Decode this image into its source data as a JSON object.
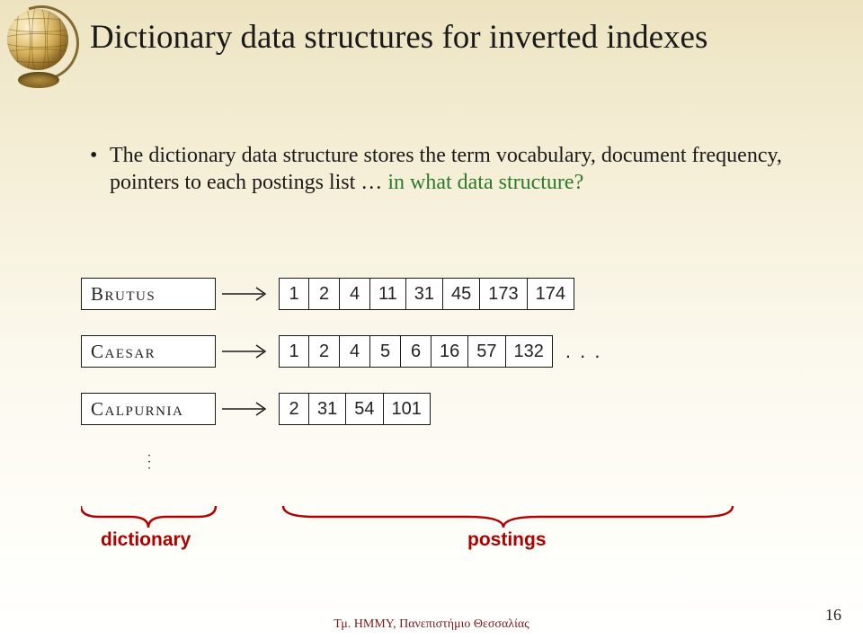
{
  "title": "Dictionary data structures for inverted indexes",
  "bullet": {
    "pre": "The dictionary data structure stores the term vocabulary, document frequency, pointers to each postings list … ",
    "question": "in what data structure?"
  },
  "terms": [
    {
      "name": "Brutus",
      "postings": [
        "1",
        "2",
        "4",
        "11",
        "31",
        "45",
        "173",
        "174"
      ],
      "more": false
    },
    {
      "name": "Caesar",
      "postings": [
        "1",
        "2",
        "4",
        "5",
        "6",
        "16",
        "57",
        "132"
      ],
      "more": true
    },
    {
      "name": "Calpurnia",
      "postings": [
        "2",
        "31",
        "54",
        "101"
      ],
      "more": false
    }
  ],
  "brace_labels": {
    "left": "dictionary",
    "right": "postings"
  },
  "footer": "Τμ. ΗΜΜΥ, Πανεπιστήμιο Θεσσαλίας",
  "page": "16"
}
